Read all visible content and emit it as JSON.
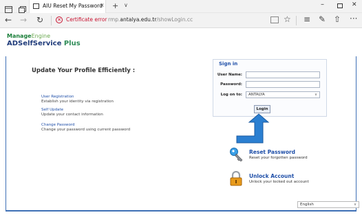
{
  "browser": {
    "tab_title": "AIU Reset My Password",
    "tab_close": "×",
    "new_tab": "+",
    "tab_dropdown": "∨",
    "back": "←",
    "forward": "→",
    "reload": "↻",
    "certificate_error": "Certificate error",
    "url_prefix": "rmp.",
    "url_domain": "antalya.edu.tr",
    "url_path": "/showLogin.cc",
    "star": "☆",
    "hub": "≡",
    "note": "✎",
    "share": "⇧",
    "more": "···",
    "minimize": "–",
    "close": "✕"
  },
  "logo": {
    "brand_a": "Manage",
    "brand_b": "Engine",
    "product_a": "ADSelfService",
    "product_b": " Plus"
  },
  "main": {
    "headline": "Update Your Profile Efficiently :",
    "links": [
      {
        "title": "User Registration",
        "desc": "Establish your identity via registration"
      },
      {
        "title": "Self Update",
        "desc": "Update your contact information"
      },
      {
        "title": "Change Password",
        "desc": "Change your password using current password"
      }
    ]
  },
  "signin": {
    "title": "Sign in",
    "username_label": "User Name:",
    "password_label": "Password:",
    "logon_label": "Log on to:",
    "logon_value": "ANTALYA",
    "login_button": "Login"
  },
  "actions": {
    "reset_title": "Reset Password",
    "reset_desc": "Reset your forgotten password",
    "unlock_title": "Unlock Account",
    "unlock_desc": "Unlock your locked out account"
  },
  "footer": {
    "language": "English"
  },
  "colors": {
    "accent": "#1f4fa8",
    "frame": "#3d6fb5",
    "error": "#c8102e",
    "arrow": "#2b7fd1"
  }
}
